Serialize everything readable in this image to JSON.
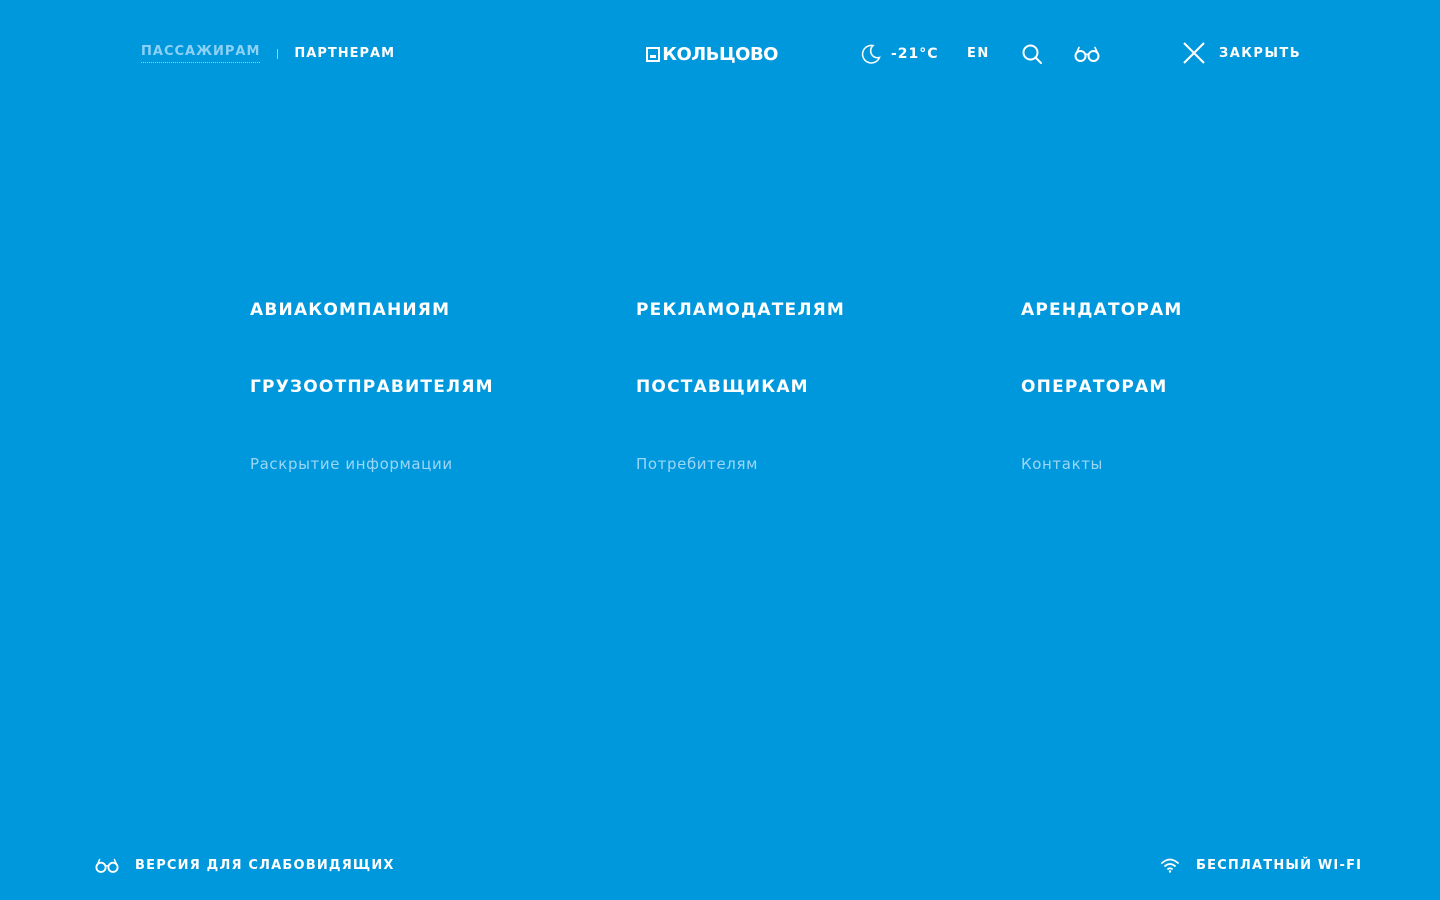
{
  "header": {
    "audience_tabs": [
      {
        "label": "ПАССАЖИРАМ",
        "active": true
      },
      {
        "label": "ПАРТНЕРАМ",
        "active": false
      }
    ],
    "logo_text": "КОЛЬЦОВО",
    "weather": {
      "icon": "moon-icon",
      "temperature": "-21°C"
    },
    "language_label": "EN",
    "search_icon": "search-icon",
    "accessibility_icon": "glasses-icon",
    "close_label": "ЗАКРЫТЬ"
  },
  "menu": {
    "primary": [
      [
        "АВИАКОМПАНИЯМ",
        "РЕКЛАМОДАТЕЛЯМ",
        "АРЕНДАТОРАМ"
      ],
      [
        "ГРУЗООТПРАВИТЕЛЯМ",
        "ПОСТАВЩИКАМ",
        "ОПЕРАТОРАМ"
      ]
    ],
    "secondary": [
      "Раскрытие информации",
      "Потребителям",
      "Контакты"
    ]
  },
  "footer": {
    "accessibility_label": "ВЕРСИЯ ДЛЯ СЛАБОВИДЯЩИХ",
    "wifi_label": "БЕСПЛАТНЫЙ WI-FI"
  },
  "colors": {
    "background": "#0098dc",
    "text": "#ffffff",
    "muted_text": "#9dd6f5"
  }
}
